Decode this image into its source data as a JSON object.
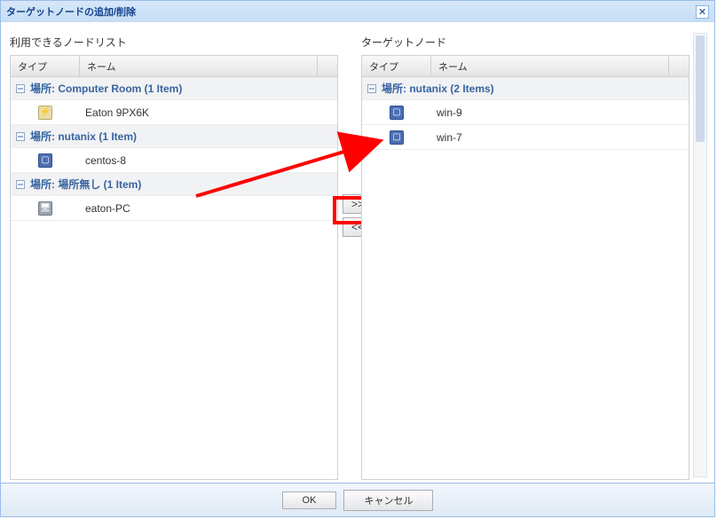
{
  "dialog": {
    "title": "ターゲットノードの追加/削除"
  },
  "buttons": {
    "add": ">>",
    "remove": "<<",
    "ok": "OK",
    "cancel": "キャンセル"
  },
  "left": {
    "title": "利用できるノードリスト",
    "col_type": "タイプ",
    "col_name": "ネーム",
    "groups": [
      {
        "label": "場所: Computer Room (1 Item)",
        "items": [
          {
            "name": "Eaton 9PX6K",
            "icon": "ups"
          }
        ]
      },
      {
        "label": "場所: nutanix (1 Item)",
        "items": [
          {
            "name": "centos-8",
            "icon": "vm"
          }
        ]
      },
      {
        "label": "場所: 場所無し (1 Item)",
        "items": [
          {
            "name": "eaton-PC",
            "icon": "pc"
          }
        ]
      }
    ]
  },
  "right": {
    "title": "ターゲットノード",
    "col_type": "タイプ",
    "col_name": "ネーム",
    "groups": [
      {
        "label": "場所: nutanix (2 Items)",
        "items": [
          {
            "name": "win-9",
            "icon": "vm"
          },
          {
            "name": "win-7",
            "icon": "vm"
          }
        ]
      }
    ]
  }
}
